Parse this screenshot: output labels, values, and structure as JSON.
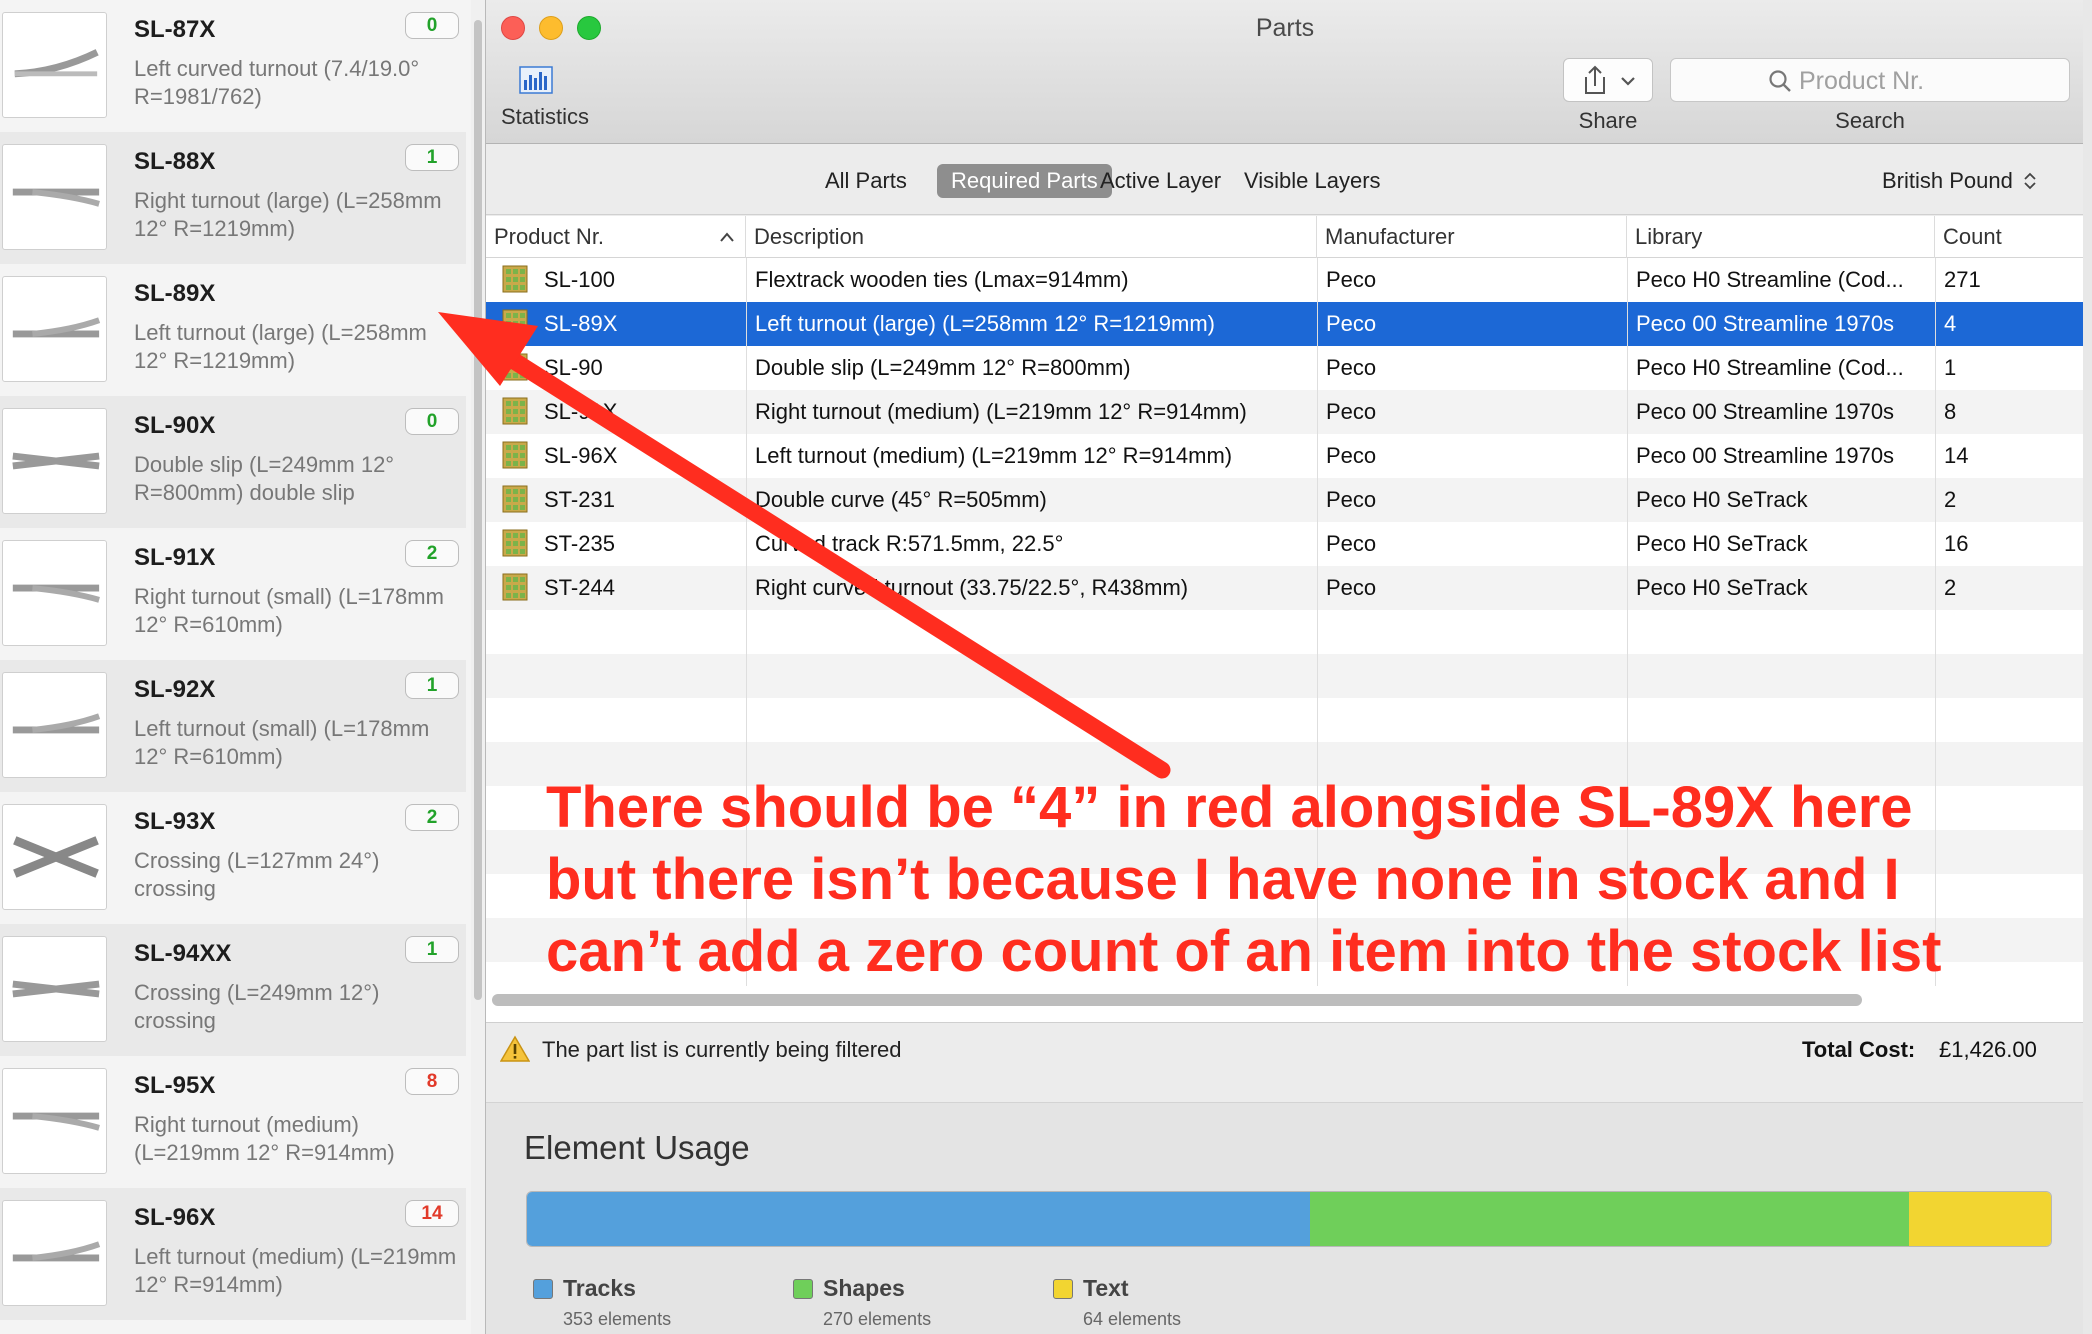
{
  "library": {
    "items": [
      {
        "name": "SL-87X",
        "desc": "Left curved turnout (7.4/19.0° R=1981/762)",
        "badge": "0",
        "badge_color": "green",
        "shape": "curve-left"
      },
      {
        "name": "SL-88X",
        "desc": "Right turnout (large)  (L=258mm 12° R=1219mm)",
        "badge": "1",
        "badge_color": "green",
        "shape": "right"
      },
      {
        "name": "SL-89X",
        "desc": "Left turnout (large)  (L=258mm 12° R=1219mm)",
        "badge": "",
        "badge_color": "",
        "shape": "left"
      },
      {
        "name": "SL-90X",
        "desc": "Double slip  (L=249mm 12° R=800mm)  double slip",
        "badge": "0",
        "badge_color": "green",
        "shape": "slip"
      },
      {
        "name": "SL-91X",
        "desc": "Right turnout (small)  (L=178mm 12° R=610mm)",
        "badge": "2",
        "badge_color": "green",
        "shape": "right"
      },
      {
        "name": "SL-92X",
        "desc": "Left turnout (small)  (L=178mm 12° R=610mm)",
        "badge": "1",
        "badge_color": "green",
        "shape": "left"
      },
      {
        "name": "SL-93X",
        "desc": "Crossing  (L=127mm 24°) crossing",
        "badge": "2",
        "badge_color": "green",
        "shape": "crossing"
      },
      {
        "name": "SL-94XX",
        "desc": "Crossing  (L=249mm 12°) crossing",
        "badge": "1",
        "badge_color": "green",
        "shape": "slip"
      },
      {
        "name": "SL-95X",
        "desc": "Right turnout (medium)  (L=219mm 12° R=914mm)",
        "badge": "8",
        "badge_color": "red",
        "shape": "right"
      },
      {
        "name": "SL-96X",
        "desc": "Left turnout (medium)  (L=219mm 12° R=914mm)",
        "badge": "14",
        "badge_color": "red",
        "shape": "left"
      }
    ]
  },
  "window": {
    "title": "Parts",
    "toolbar": {
      "statistics_label": "Statistics",
      "share_label": "Share",
      "search_label": "Search",
      "search_placeholder": "Product Nr."
    }
  },
  "filters": {
    "tabs": [
      {
        "label": "All Parts",
        "selected": false
      },
      {
        "label": "Required Parts",
        "selected": true
      },
      {
        "label": "Active Layer",
        "selected": false
      },
      {
        "label": "Visible Layers",
        "selected": false
      }
    ],
    "currency": "British Pound"
  },
  "table": {
    "columns": [
      "Product Nr.",
      "Description",
      "Manufacturer",
      "Library",
      "Count"
    ],
    "rows": [
      {
        "product": "SL-100",
        "description": "Flextrack wooden ties (Lmax=914mm)",
        "manufacturer": "Peco",
        "library": "Peco H0 Streamline (Cod...",
        "count": "271"
      },
      {
        "product": "SL-89X",
        "description": "Left turnout (large)  (L=258mm 12° R=1219mm)",
        "manufacturer": "Peco",
        "library": "Peco 00 Streamline 1970s",
        "count": "4",
        "selected": true
      },
      {
        "product": "SL-90",
        "description": "Double slip (L=249mm 12° R=800mm)",
        "manufacturer": "Peco",
        "library": "Peco H0 Streamline (Cod...",
        "count": "1"
      },
      {
        "product": "SL-91X",
        "description": "Right turnout (medium)  (L=219mm 12° R=914mm)",
        "manufacturer": "Peco",
        "library": "Peco 00 Streamline 1970s",
        "count": "8"
      },
      {
        "product": "SL-96X",
        "description": "Left turnout (medium)  (L=219mm 12° R=914mm)",
        "manufacturer": "Peco",
        "library": "Peco 00 Streamline 1970s",
        "count": "14"
      },
      {
        "product": "ST-231",
        "description": "Double curve (45° R=505mm)",
        "manufacturer": "Peco",
        "library": "Peco H0 SeTrack",
        "count": "2"
      },
      {
        "product": "ST-235",
        "description": "Curved track R:571.5mm, 22.5°",
        "manufacturer": "Peco",
        "library": "Peco H0 SeTrack",
        "count": "16"
      },
      {
        "product": "ST-244",
        "description": "Right curved turnout (33.75/22.5°, R438mm)",
        "manufacturer": "Peco",
        "library": "Peco H0 SeTrack",
        "count": "2"
      }
    ]
  },
  "status": {
    "text": "The part list is currently being filtered",
    "total_label": "Total Cost:",
    "total_value": "£1,426.00"
  },
  "usage": {
    "title": "Element Usage",
    "segments": [
      {
        "name": "Tracks",
        "count_text": "353 elements",
        "value": 353,
        "color": "#54a0dc"
      },
      {
        "name": "Shapes",
        "count_text": "270 elements",
        "value": 270,
        "color": "#6fcf5a"
      },
      {
        "name": "Text",
        "count_text": "64 elements",
        "value": 64,
        "color": "#f2d531"
      }
    ]
  },
  "annotation": {
    "lines": [
      "There should be “4” in red alongside SL-89X here",
      "but there isn’t because I have none in stock and I",
      "can’t add a zero count of an item into the stock list"
    ],
    "color": "#ff2d1f"
  }
}
